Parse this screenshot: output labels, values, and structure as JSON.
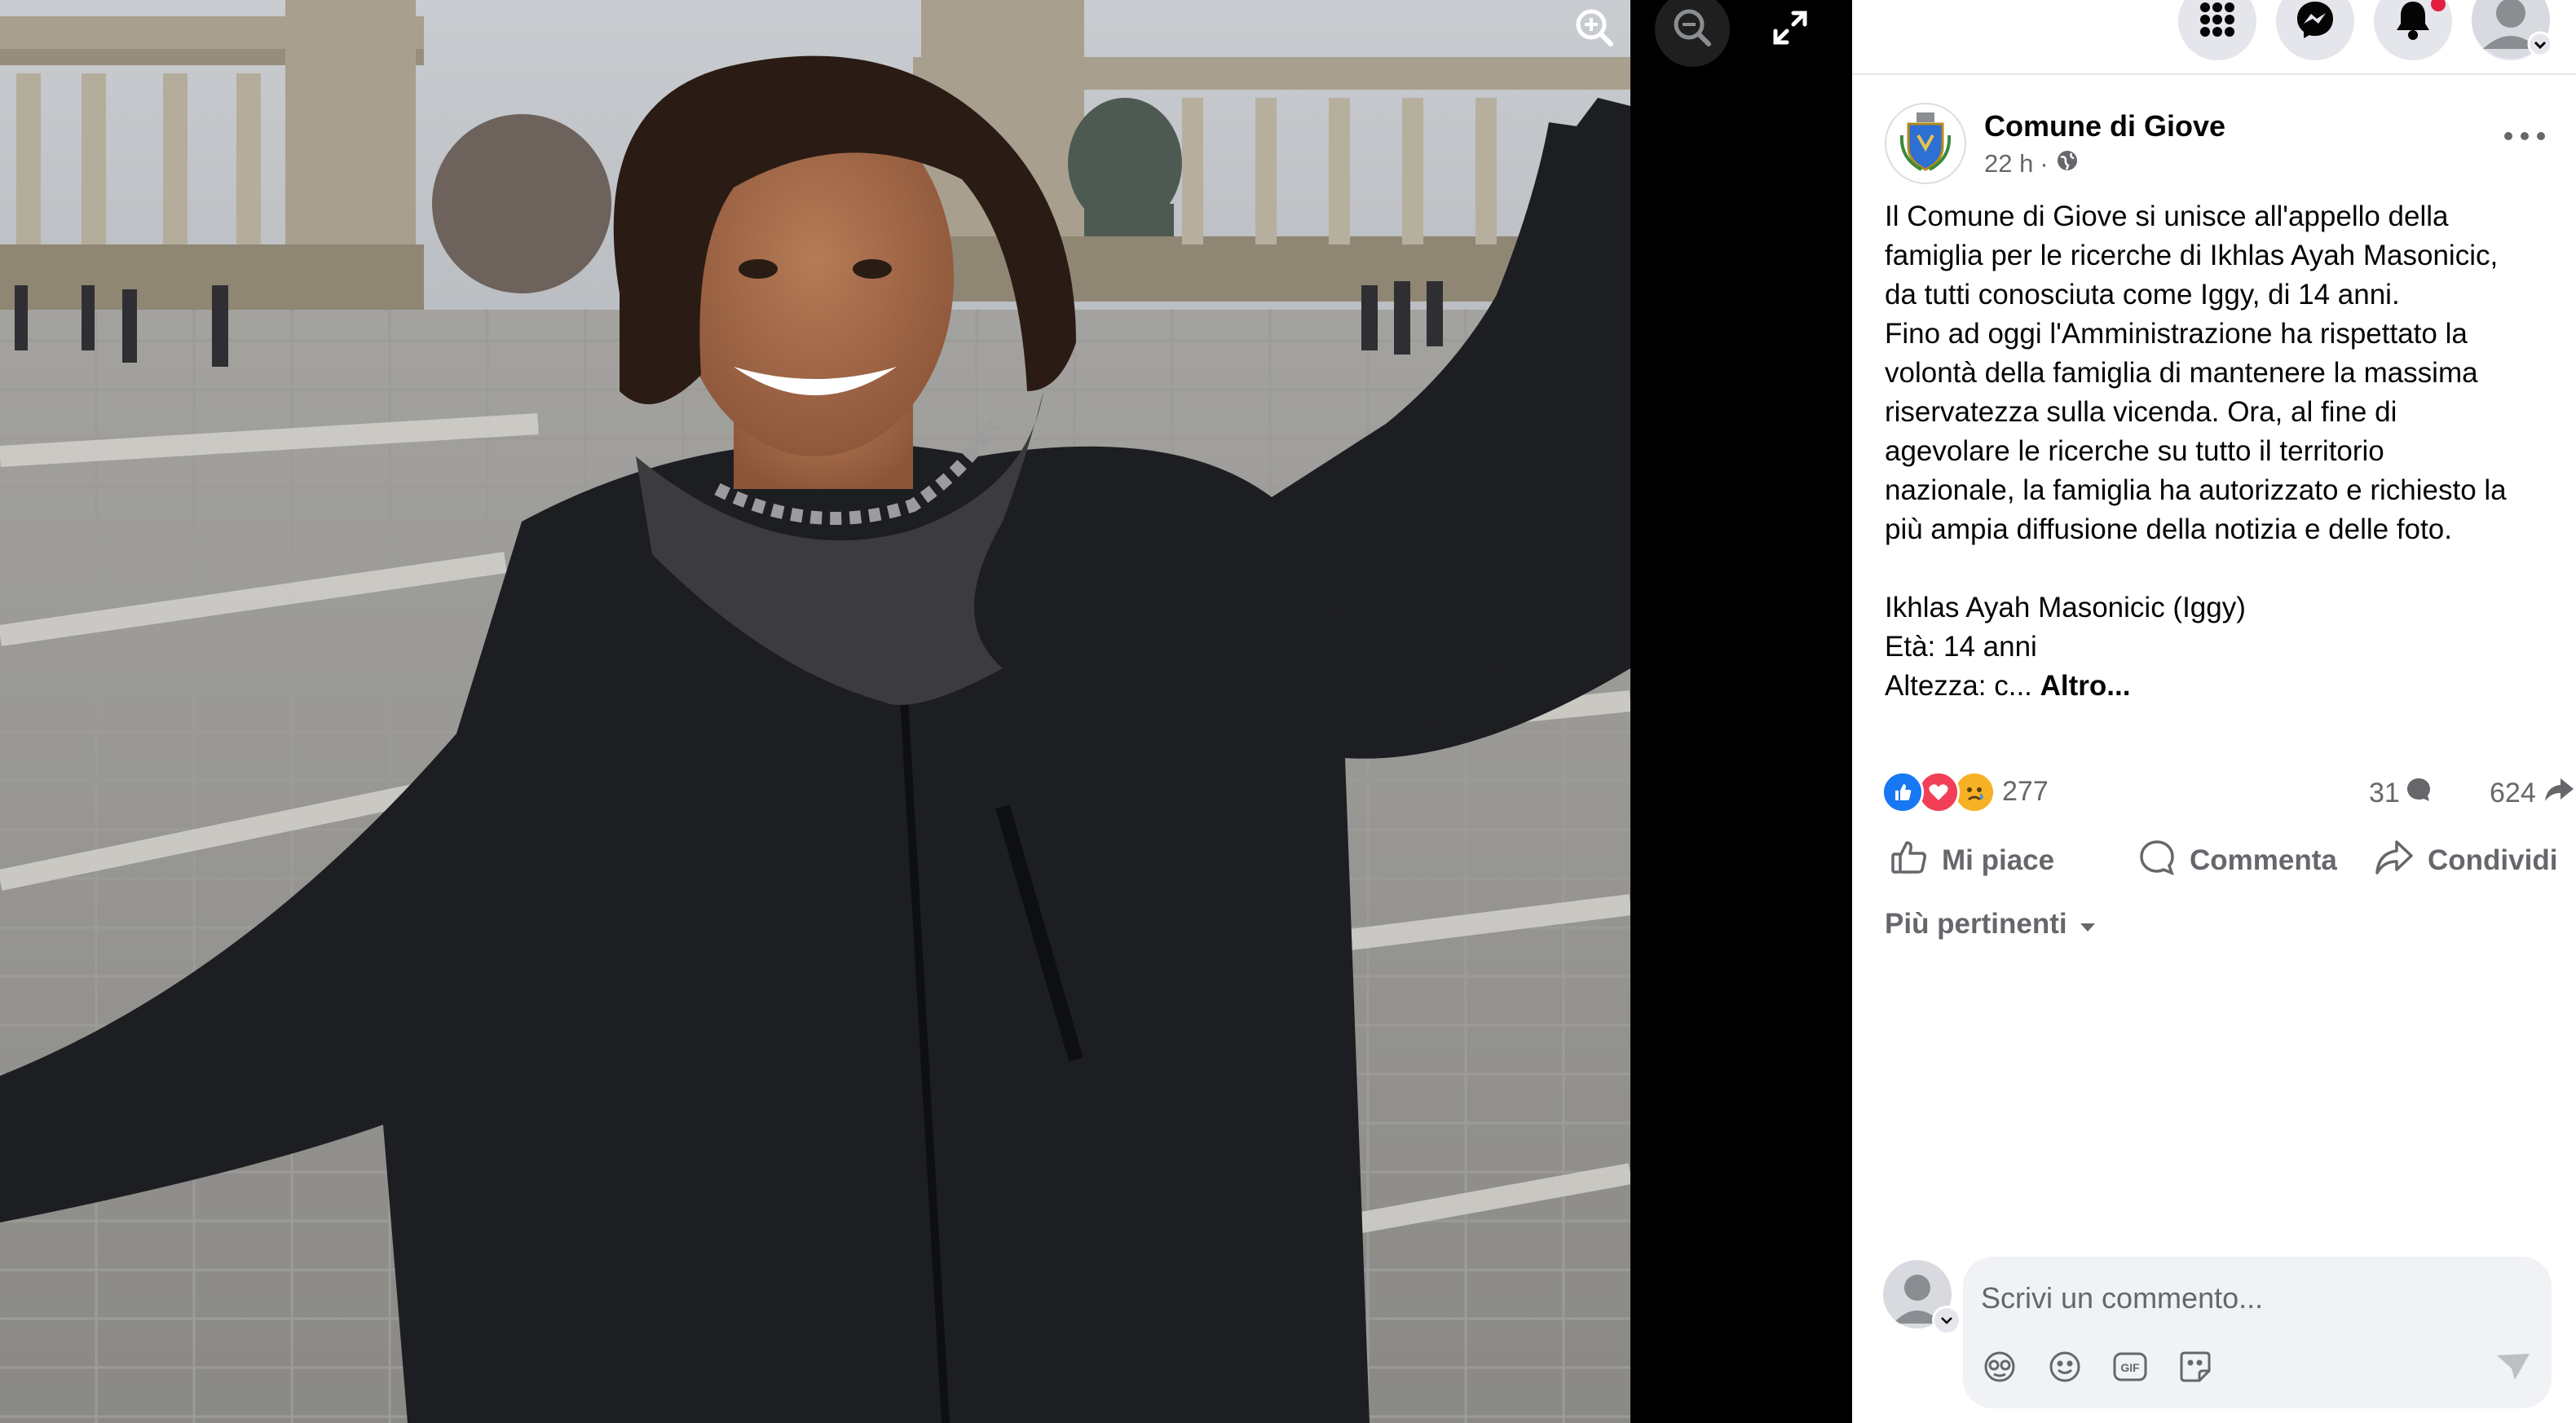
{
  "viewer": {
    "buttons": [
      "zoom-in",
      "zoom-out",
      "fullscreen"
    ]
  },
  "topbar": {
    "icons": [
      "grid-menu-icon",
      "messenger-icon",
      "bell-icon",
      "account-avatar"
    ]
  },
  "post": {
    "page_name": "Comune di Giove",
    "time": "22 h",
    "separator": "·",
    "privacy_icon": "globe-icon",
    "body_lines": [
      "Il Comune di Giove si unisce all'appello della",
      "famiglia per le ricerche di Ikhlas Ayah Masonicic,",
      "da tutti conosciuta come Iggy, di 14 anni.",
      "Fino ad oggi l'Amministrazione ha rispettato la",
      "volontà della famiglia di mantenere la massima",
      "riservatezza sulla vicenda. Ora, al fine di",
      "agevolare le ricerche su tutto il territorio",
      "nazionale, la famiglia ha autorizzato e richiesto la",
      "più ampia diffusione della notizia e delle foto."
    ],
    "details_lines": [
      "Ikhlas Ayah Masonicic (Iggy)",
      "Età: 14 anni"
    ],
    "truncated_line": "Altezza: c...",
    "see_more": "Altro..."
  },
  "stats": {
    "reactions": [
      "like",
      "love",
      "sad"
    ],
    "reaction_count": "277",
    "comment_count": "31",
    "share_count": "624"
  },
  "actions": {
    "like": "Mi piace",
    "comment": "Commenta",
    "share": "Condividi"
  },
  "sort": {
    "label": "Più pertinenti"
  },
  "composer": {
    "placeholder": "Scrivi un commento...",
    "tools": [
      "avatar-sticker-icon",
      "emoji-icon",
      "gif-icon",
      "sticker-icon",
      "send-icon"
    ]
  },
  "colors": {
    "brand_blue": "#1877f2",
    "love_red": "#f33e58",
    "sad_yellow": "#f7b125",
    "secondary_text": "#65676b",
    "notification_red": "#e41e3f"
  }
}
